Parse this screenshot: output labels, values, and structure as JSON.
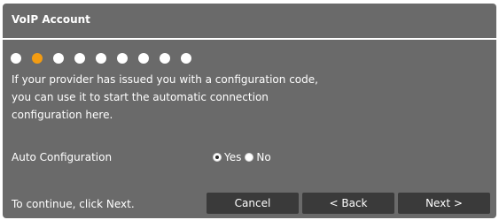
{
  "panel": {
    "title": "VoIP Account"
  },
  "wizard": {
    "steps_total": 9,
    "current_step": 2
  },
  "intro": {
    "lines": [
      "If your provider has issued you with a configuration code,",
      "you can use it to start the automatic connection",
      "configuration here."
    ]
  },
  "auto_config": {
    "label": "Auto Configuration",
    "options": [
      "Yes",
      "No"
    ],
    "selected": "Yes"
  },
  "footer": {
    "hint": "To continue, click Next.",
    "cancel_label": "Cancel",
    "back_label": "< Back",
    "next_label": "Next >"
  },
  "colors": {
    "panel_bg": "#6a6a6a",
    "button_bg": "#3a3a3a",
    "active_step": "#f39c12",
    "inactive_step": "#ffffff",
    "text": "#ffffff"
  }
}
